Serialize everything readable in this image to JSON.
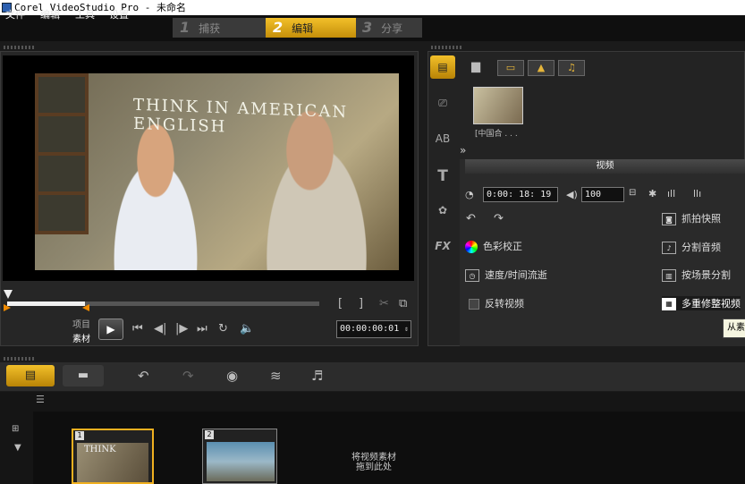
{
  "window": {
    "title": "Corel VideoStudio Pro - 未命名"
  },
  "menu": {
    "file": "文件",
    "edit": "编辑",
    "tools": "工具",
    "settings": "设置"
  },
  "steps": [
    {
      "num": "1",
      "label": "捕获"
    },
    {
      "num": "2",
      "label": "编辑"
    },
    {
      "num": "3",
      "label": "分享"
    }
  ],
  "player": {
    "video_caption": "THINK IN AMERICAN ENGLISH",
    "mode_project": "项目",
    "mode_clip": "素材",
    "timecode": "00:00:00:01",
    "scrub_fraction": 0.25,
    "mark_in": "[",
    "mark_out": "]"
  },
  "library": {
    "thumb_label": "[中国合 . . ."
  },
  "options": {
    "title": "视频",
    "duration": "0:00: 18: 19",
    "volume": "100",
    "color_correct": "色彩校正",
    "speed_time": "速度/时间流逝",
    "reverse": "反转视频",
    "snapshot": "抓拍快照",
    "split_audio": "分割音频",
    "split_scene": "按场景分割",
    "multi_trim": "多重修整视频",
    "tooltip": "从素"
  },
  "timeline": {
    "clip1_num": "1",
    "clip1_text": "THINK",
    "clip2_num": "2",
    "drop_hint": "将视频素材拖到此处"
  }
}
